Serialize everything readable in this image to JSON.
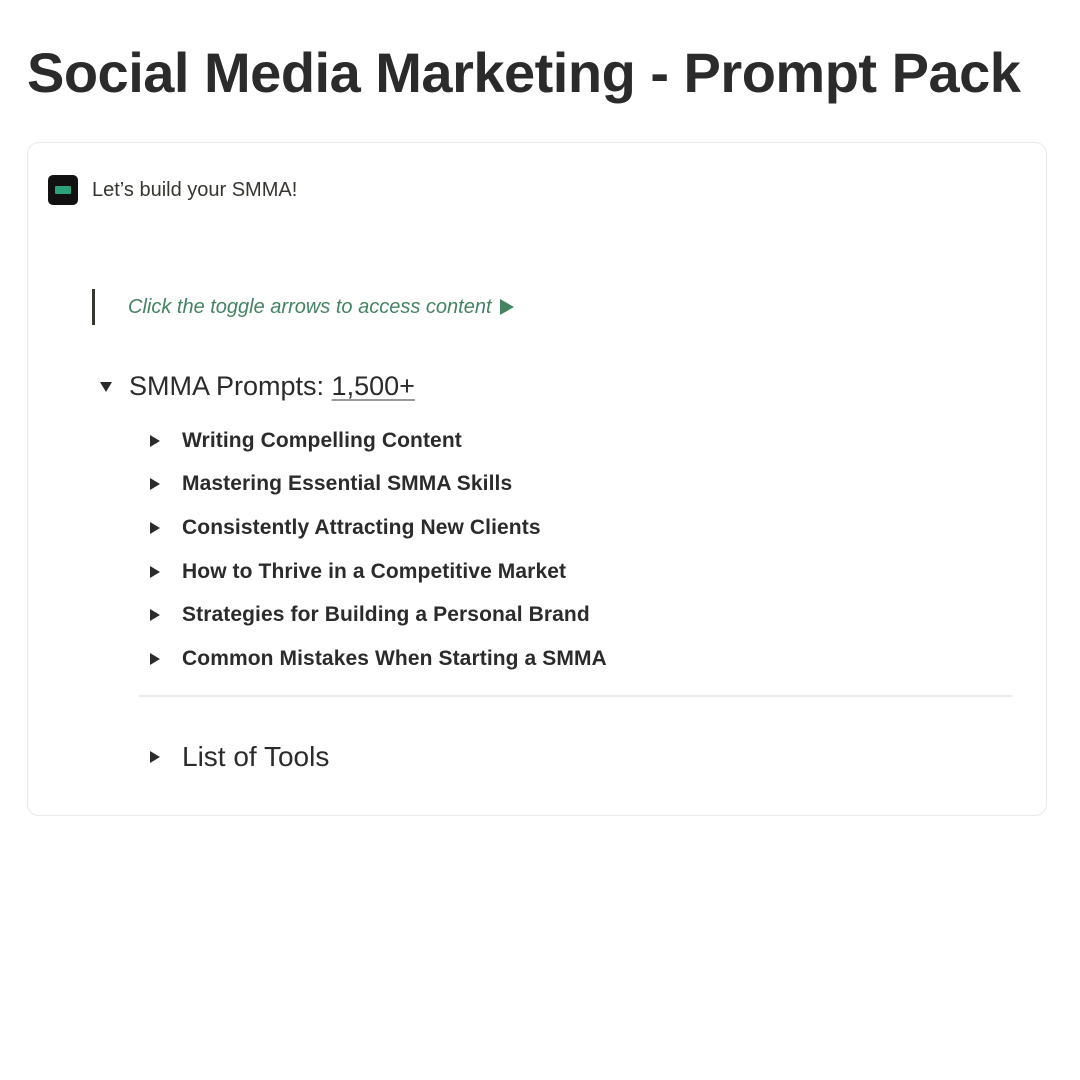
{
  "page": {
    "title": "Social Media Marketing - Prompt Pack"
  },
  "callout": {
    "text": "Let’s build your SMMA!",
    "icon": "smma-logo-icon"
  },
  "hint": {
    "text": "Click the toggle arrows to access content",
    "arrow": "▶",
    "color": "#448361"
  },
  "prompts_toggle": {
    "label": "SMMA Prompts: ",
    "count": "1,500+",
    "expanded": true,
    "items": [
      {
        "label": "Writing Compelling Content"
      },
      {
        "label": "Mastering Essential SMMA Skills"
      },
      {
        "label": "Consistently Attracting New Clients"
      },
      {
        "label": "How to Thrive in a Competitive Market"
      },
      {
        "label": "Strategies for Building a Personal Brand"
      },
      {
        "label": "Common Mistakes When Starting a SMMA"
      }
    ]
  },
  "tools_toggle": {
    "label": "List of Tools",
    "expanded": false
  }
}
